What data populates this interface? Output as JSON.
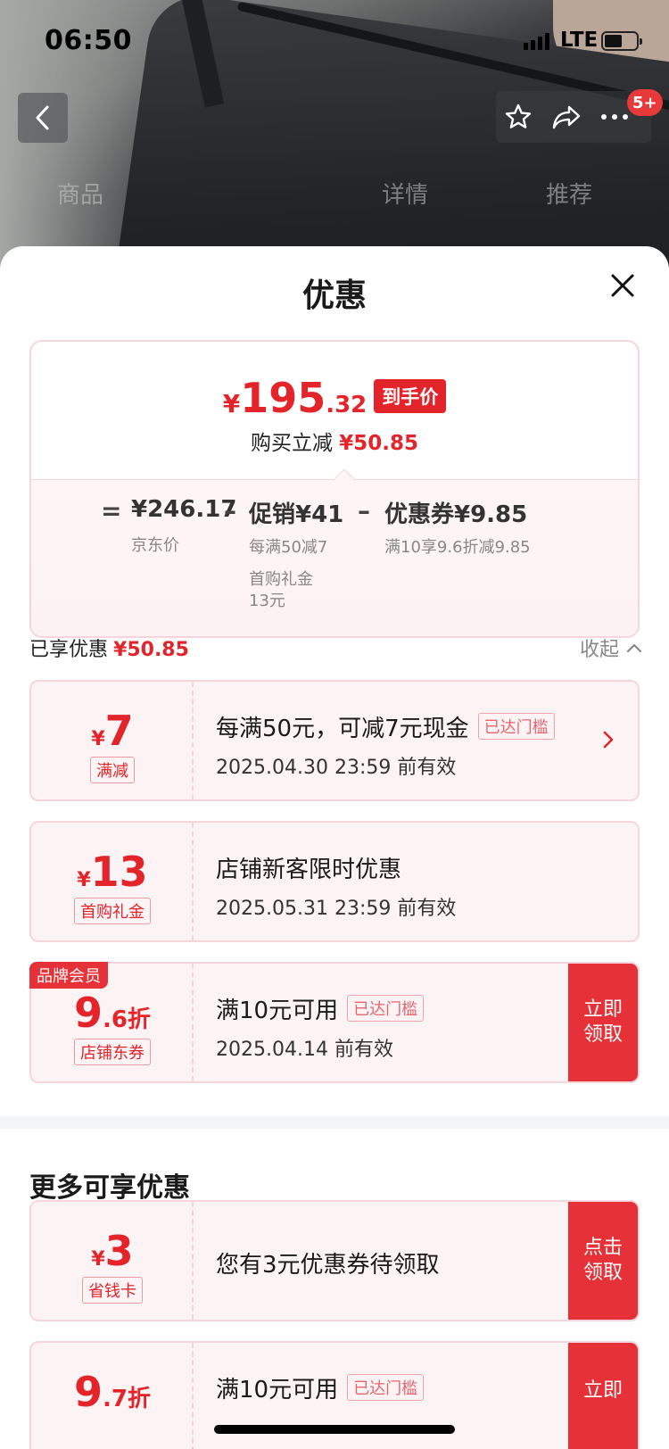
{
  "status": {
    "time": "06:50",
    "network": "LTE"
  },
  "nav": {
    "badge": "5+",
    "tabs": [
      "商品",
      "详情",
      "推荐"
    ]
  },
  "sheet": {
    "title": "优惠",
    "final_price": {
      "yen": "¥",
      "int": "195",
      "dec": ".32",
      "tag": "到手价"
    },
    "reduce": {
      "label": "购买立减",
      "amount": "¥50.85"
    },
    "formula": {
      "eq": "=",
      "minus": "–",
      "jd_price": "¥246.17",
      "jd_price_label": "京东价",
      "promo": "促销¥41",
      "promo_sub1": "每满50减7",
      "promo_sub2": "首购礼金",
      "promo_sub3": "13元",
      "coupon": "优惠券¥9.85",
      "coupon_sub": "满10享9.6折减9.85"
    },
    "enjoyed": {
      "label": "已享优惠",
      "amount": "¥50.85",
      "collapse": "收起"
    },
    "coupons": [
      {
        "yen": "¥",
        "value": "7",
        "tag": "满减",
        "line1": "每满50元，可减7元现金",
        "reached": "已达门槛",
        "line2": "2025.04.30 23:59 前有效"
      },
      {
        "yen": "¥",
        "value": "13",
        "tag": "首购礼金",
        "line1": "店铺新客限时优惠",
        "line2": "2025.05.31 23:59 前有效"
      },
      {
        "member": "品牌会员",
        "value": "9",
        "dec": ".6折",
        "tag": "店铺东券",
        "line1": "满10元可用",
        "reached": "已达门槛",
        "line2": "2025.04.14 前有效",
        "action": "立即领取"
      }
    ],
    "more_title": "更多可享优惠",
    "more": [
      {
        "yen": "¥",
        "value": "3",
        "tag": "省钱卡",
        "line1": "您有3元优惠券待领取",
        "action": "点击领取"
      },
      {
        "value": "9",
        "dec": ".7折",
        "line1": "满10元可用",
        "reached": "已达门槛",
        "action": "立即"
      }
    ]
  }
}
